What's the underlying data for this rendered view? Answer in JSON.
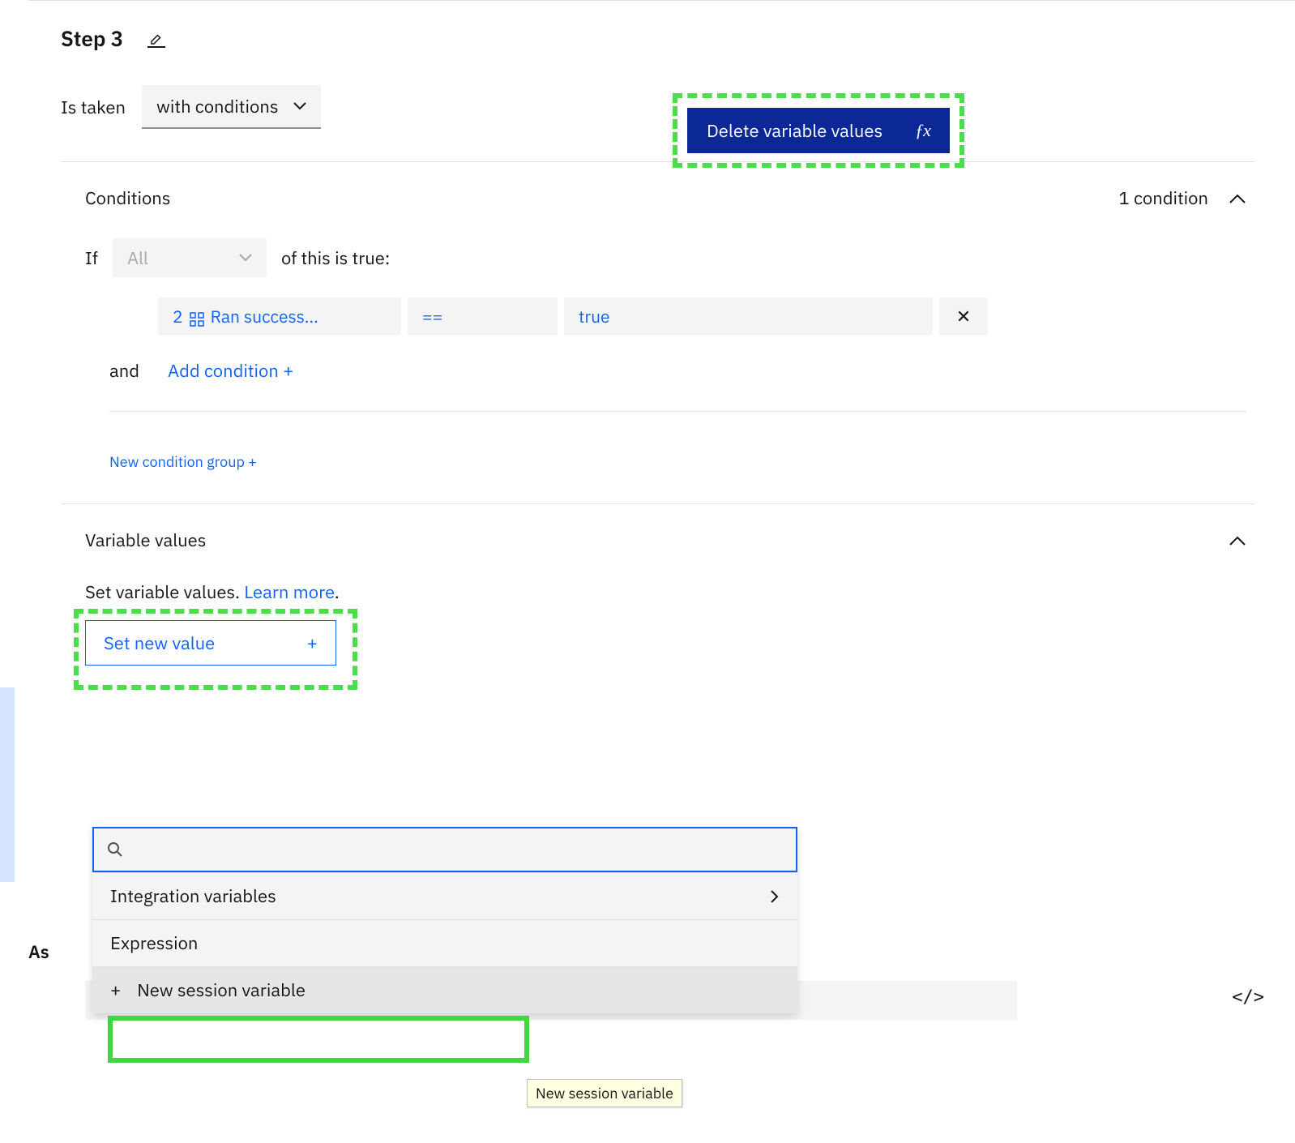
{
  "step": {
    "title": "Step 3"
  },
  "istaken": {
    "label": "Is taken",
    "dropdown": "with conditions"
  },
  "action_chip": {
    "label": "Delete variable values",
    "fx": "ƒx"
  },
  "conditions": {
    "title": "Conditions",
    "count_label": "1 condition",
    "if": "If",
    "all": "All",
    "of_true": "of this is true:",
    "row": {
      "left_num": "2",
      "left_text": "Ran success...",
      "op": "==",
      "val": "true",
      "del": "✕"
    },
    "and": "and",
    "add_condition": "Add condition  +",
    "new_group": "New condition group  +"
  },
  "variables": {
    "title": "Variable values",
    "desc_pre": "Set variable values. ",
    "learn_more": "Learn more",
    "desc_post": ".",
    "set_new": "Set new value",
    "plus": "+"
  },
  "popover": {
    "search_placeholder": "",
    "items": {
      "integration": "Integration variables",
      "expression": "Expression",
      "new_session": "New session variable"
    }
  },
  "assistant_label": "As",
  "tooltip": "New session variable",
  "code_toggle": "</>"
}
